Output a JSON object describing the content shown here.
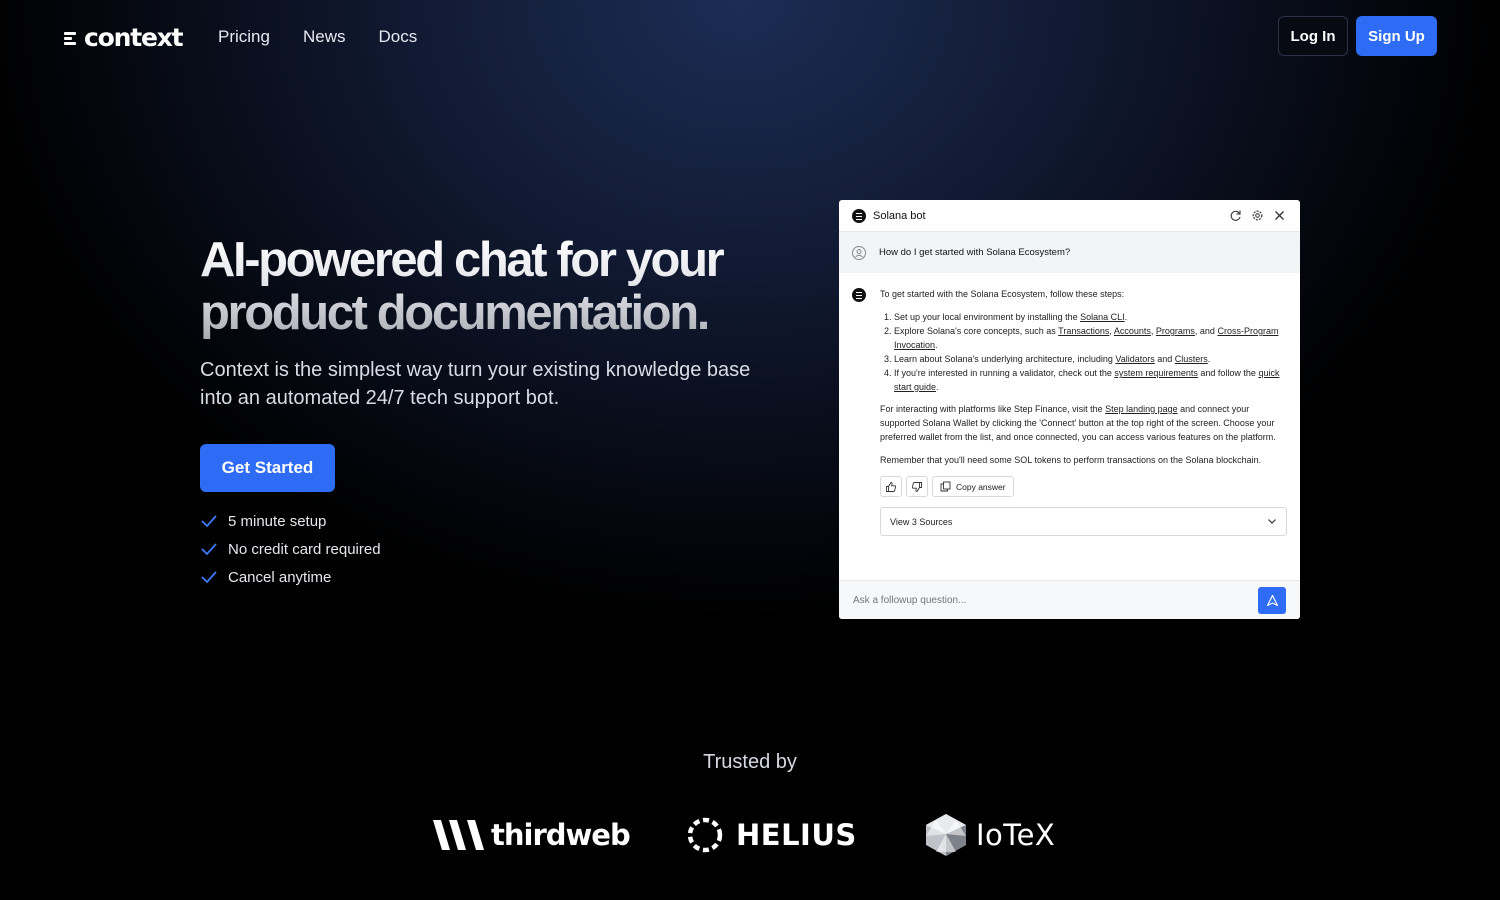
{
  "nav": {
    "logo_text": "context",
    "links": [
      "Pricing",
      "News",
      "Docs"
    ],
    "login_label": "Log In",
    "signup_label": "Sign Up"
  },
  "hero": {
    "title_line1": "AI-powered chat for your",
    "title_line2": "product documentation.",
    "subtitle": "Context is the simplest way turn your existing knowledge base into an automated 24/7 tech support bot.",
    "cta_label": "Get Started",
    "features": [
      "5 minute setup",
      "No credit card required",
      "Cancel anytime"
    ]
  },
  "chat": {
    "title": "Solana bot",
    "question": "How do I get started with Solana Ecosystem?",
    "intro": "To get started with the Solana Ecosystem, follow these steps:",
    "steps": [
      {
        "before": "Set up your local environment by installing the ",
        "links": [
          "Solana CLI"
        ],
        "after": "."
      },
      {
        "before": "Explore Solana's core concepts, such as ",
        "links": [
          "Transactions",
          "Accounts",
          "Programs",
          "Cross-Program Invocation"
        ],
        "after": "."
      },
      {
        "before": "Learn about Solana's underlying architecture, including ",
        "links": [
          "Validators",
          "Clusters"
        ],
        "after": "."
      },
      {
        "before": "If you're interested in running a validator, check out the ",
        "links": [
          "system requirements",
          "quick start guide"
        ],
        "after": "."
      }
    ],
    "para2_before": "For interacting with platforms like Step Finance, visit the ",
    "para2_link": "Step landing page",
    "para2_after": " and connect your supported Solana Wallet by clicking the 'Connect' button at the top right of the screen. Choose your preferred wallet from the list, and once connected, you can access various features on the platform.",
    "para3": "Remember that you'll need some SOL tokens to perform transactions on the Solana blockchain.",
    "copy_label": "Copy answer",
    "sources_label": "View 3 Sources",
    "followup_placeholder": "Ask a followup question..."
  },
  "trusted": {
    "heading": "Trusted by",
    "logos": [
      "thirdweb",
      "HELIUS",
      "IoTeX"
    ]
  },
  "colors": {
    "accent": "#2f6cf5",
    "background_top": "#1c2c54",
    "background_bottom": "#000000"
  }
}
